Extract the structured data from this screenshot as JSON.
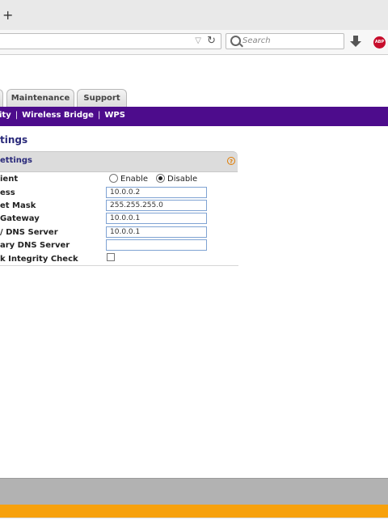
{
  "browser": {
    "new_tab_label": "+",
    "search_placeholder": "Search",
    "icons": [
      "plus-icon",
      "dropmarker-icon",
      "reload-icon",
      "search-icon",
      "download-icon",
      "adblock-icon"
    ],
    "abp_label": "ABP"
  },
  "tabs": [
    {
      "label": "Maintenance"
    },
    {
      "label": "Support"
    }
  ],
  "submenu": {
    "items": [
      "ity",
      "Wireless Bridge",
      "WPS"
    ],
    "separator": "|"
  },
  "page": {
    "title": "tings"
  },
  "section": {
    "title": "ettings",
    "help_label": "?"
  },
  "form": {
    "client_label": "ient",
    "enable_label": "Enable",
    "disable_label": "Disable",
    "selected": "Disable",
    "ip_label": "ess",
    "ip_value": "10.0.0.2",
    "subnet_label": "et Mask",
    "subnet_value": "255.255.255.0",
    "gateway_label": "Gateway",
    "gateway_value": "10.0.0.1",
    "primary_dns_label": "/ DNS Server",
    "primary_dns_value": "10.0.0.1",
    "secondary_dns_label": "ary DNS Server",
    "secondary_dns_value": "",
    "integrity_label": "k Integrity Check",
    "integrity_checked": false
  },
  "colors": {
    "purple_nav": "#4d0c8c",
    "orange_bar": "#f7a10d",
    "gray_bar": "#b2b2b2",
    "title_blue": "#2a2a7a"
  }
}
